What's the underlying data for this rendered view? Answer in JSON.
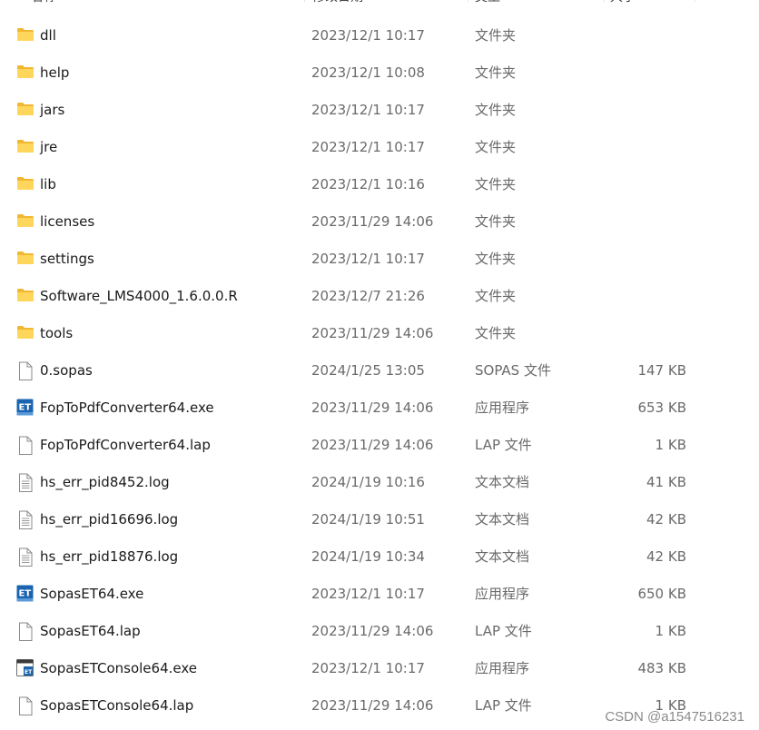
{
  "columns": {
    "name": "名称",
    "modified": "修改日期",
    "type": "类型",
    "size": "大小"
  },
  "files": [
    {
      "name": "dll",
      "modified": "2023/12/1 10:17",
      "type": "文件夹",
      "size": "",
      "icon": "folder-icon"
    },
    {
      "name": "help",
      "modified": "2023/12/1 10:08",
      "type": "文件夹",
      "size": "",
      "icon": "folder-icon"
    },
    {
      "name": "jars",
      "modified": "2023/12/1 10:17",
      "type": "文件夹",
      "size": "",
      "icon": "folder-icon"
    },
    {
      "name": "jre",
      "modified": "2023/12/1 10:17",
      "type": "文件夹",
      "size": "",
      "icon": "folder-icon"
    },
    {
      "name": "lib",
      "modified": "2023/12/1 10:16",
      "type": "文件夹",
      "size": "",
      "icon": "folder-icon"
    },
    {
      "name": "licenses",
      "modified": "2023/11/29 14:06",
      "type": "文件夹",
      "size": "",
      "icon": "folder-icon"
    },
    {
      "name": "settings",
      "modified": "2023/12/1 10:17",
      "type": "文件夹",
      "size": "",
      "icon": "folder-icon"
    },
    {
      "name": "Software_LMS4000_1.6.0.0.R",
      "modified": "2023/12/7 21:26",
      "type": "文件夹",
      "size": "",
      "icon": "folder-icon"
    },
    {
      "name": "tools",
      "modified": "2023/11/29 14:06",
      "type": "文件夹",
      "size": "",
      "icon": "folder-icon"
    },
    {
      "name": "0.sopas",
      "modified": "2024/1/25 13:05",
      "type": "SOPAS 文件",
      "size": "147 KB",
      "icon": "file-icon"
    },
    {
      "name": "FopToPdfConverter64.exe",
      "modified": "2023/11/29 14:06",
      "type": "应用程序",
      "size": "653 KB",
      "icon": "et-app-icon"
    },
    {
      "name": "FopToPdfConverter64.lap",
      "modified": "2023/11/29 14:06",
      "type": "LAP 文件",
      "size": "1 KB",
      "icon": "file-icon"
    },
    {
      "name": "hs_err_pid8452.log",
      "modified": "2024/1/19 10:16",
      "type": "文本文档",
      "size": "41 KB",
      "icon": "text-file-icon"
    },
    {
      "name": "hs_err_pid16696.log",
      "modified": "2024/1/19 10:51",
      "type": "文本文档",
      "size": "42 KB",
      "icon": "text-file-icon"
    },
    {
      "name": "hs_err_pid18876.log",
      "modified": "2024/1/19 10:34",
      "type": "文本文档",
      "size": "42 KB",
      "icon": "text-file-icon"
    },
    {
      "name": "SopasET64.exe",
      "modified": "2023/12/1 10:17",
      "type": "应用程序",
      "size": "650 KB",
      "icon": "et-app-icon"
    },
    {
      "name": "SopasET64.lap",
      "modified": "2023/11/29 14:06",
      "type": "LAP 文件",
      "size": "1 KB",
      "icon": "file-icon"
    },
    {
      "name": "SopasETConsole64.exe",
      "modified": "2023/12/1 10:17",
      "type": "应用程序",
      "size": "483 KB",
      "icon": "console-app-icon"
    },
    {
      "name": "SopasETConsole64.lap",
      "modified": "2023/11/29 14:06",
      "type": "LAP 文件",
      "size": "1 KB",
      "icon": "file-icon"
    }
  ],
  "watermark": "CSDN @a1547516231"
}
